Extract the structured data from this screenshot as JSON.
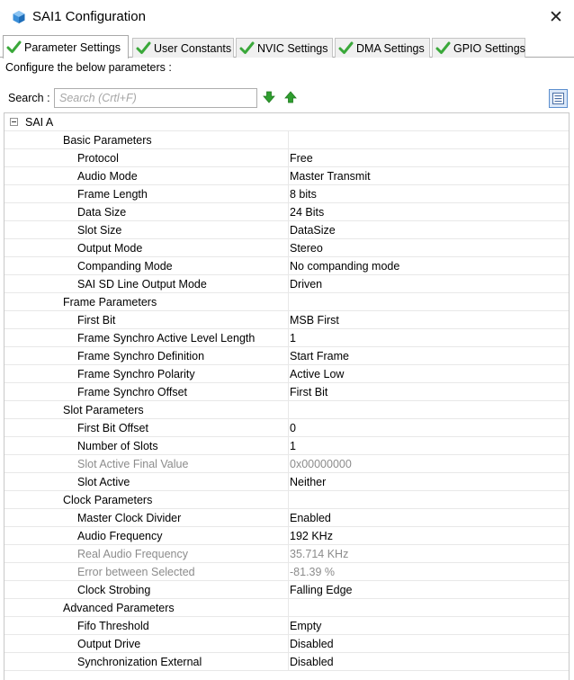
{
  "window": {
    "title": "SAI1 Configuration",
    "close_glyph": "✕"
  },
  "tabs": [
    {
      "label": "Parameter Settings",
      "icon": "check-icon",
      "active": true
    },
    {
      "label": "User Constants",
      "icon": "check-icon",
      "active": false
    },
    {
      "label": "NVIC Settings",
      "icon": "check-icon",
      "active": false
    },
    {
      "label": "DMA Settings",
      "icon": "check-icon",
      "active": false
    },
    {
      "label": "GPIO Settings",
      "icon": "check-icon",
      "active": false
    }
  ],
  "configure_label": "Configure the below parameters :",
  "search": {
    "label": "Search :",
    "placeholder": "Search (Crtl+F)",
    "value": ""
  },
  "colors": {
    "accent_green": "#2f9e2f",
    "check_green": "#3aa83a",
    "disabled_text": "#8c8c8c",
    "view_button_border": "#5d8fcf",
    "view_button_bg": "#dbe8f8"
  },
  "tree": {
    "root": "SAI A",
    "groups": [
      {
        "name": "Basic Parameters",
        "params": [
          {
            "name": "Protocol",
            "value": "Free",
            "disabled": false
          },
          {
            "name": "Audio Mode",
            "value": "Master Transmit",
            "disabled": false
          },
          {
            "name": "Frame Length",
            "value": "8 bits",
            "disabled": false
          },
          {
            "name": "Data Size",
            "value": "24 Bits",
            "disabled": false
          },
          {
            "name": "Slot Size",
            "value": "DataSize",
            "disabled": false
          },
          {
            "name": "Output Mode",
            "value": "Stereo",
            "disabled": false
          },
          {
            "name": "Companding Mode",
            "value": "No companding mode",
            "disabled": false
          },
          {
            "name": "SAI SD Line Output Mode",
            "value": "Driven",
            "disabled": false
          }
        ]
      },
      {
        "name": "Frame Parameters",
        "params": [
          {
            "name": "First Bit",
            "value": "MSB First",
            "disabled": false
          },
          {
            "name": "Frame Synchro Active Level Length",
            "value": "1",
            "disabled": false
          },
          {
            "name": "Frame Synchro Definition",
            "value": "Start Frame",
            "disabled": false
          },
          {
            "name": "Frame Synchro Polarity",
            "value": "Active Low",
            "disabled": false
          },
          {
            "name": "Frame Synchro Offset",
            "value": "First Bit",
            "disabled": false
          }
        ]
      },
      {
        "name": "Slot Parameters",
        "params": [
          {
            "name": "First Bit Offset",
            "value": "0",
            "disabled": false
          },
          {
            "name": "Number of Slots",
            "value": "1",
            "disabled": false
          },
          {
            "name": "Slot Active Final Value",
            "value": "0x00000000",
            "disabled": true
          },
          {
            "name": "Slot Active",
            "value": "Neither",
            "disabled": false
          }
        ]
      },
      {
        "name": "Clock Parameters",
        "params": [
          {
            "name": "Master Clock Divider",
            "value": "Enabled",
            "disabled": false
          },
          {
            "name": "Audio Frequency",
            "value": "192 KHz",
            "disabled": false
          },
          {
            "name": "Real Audio Frequency",
            "value": "35.714 KHz",
            "disabled": true
          },
          {
            "name": "Error between Selected",
            "value": "-81.39 %",
            "disabled": true
          },
          {
            "name": "Clock Strobing",
            "value": "Falling Edge",
            "disabled": false
          }
        ]
      },
      {
        "name": "Advanced Parameters",
        "params": [
          {
            "name": "Fifo Threshold",
            "value": "Empty",
            "disabled": false
          },
          {
            "name": "Output Drive",
            "value": "Disabled",
            "disabled": false
          },
          {
            "name": "Synchronization External",
            "value": "Disabled",
            "disabled": false
          }
        ]
      }
    ]
  }
}
